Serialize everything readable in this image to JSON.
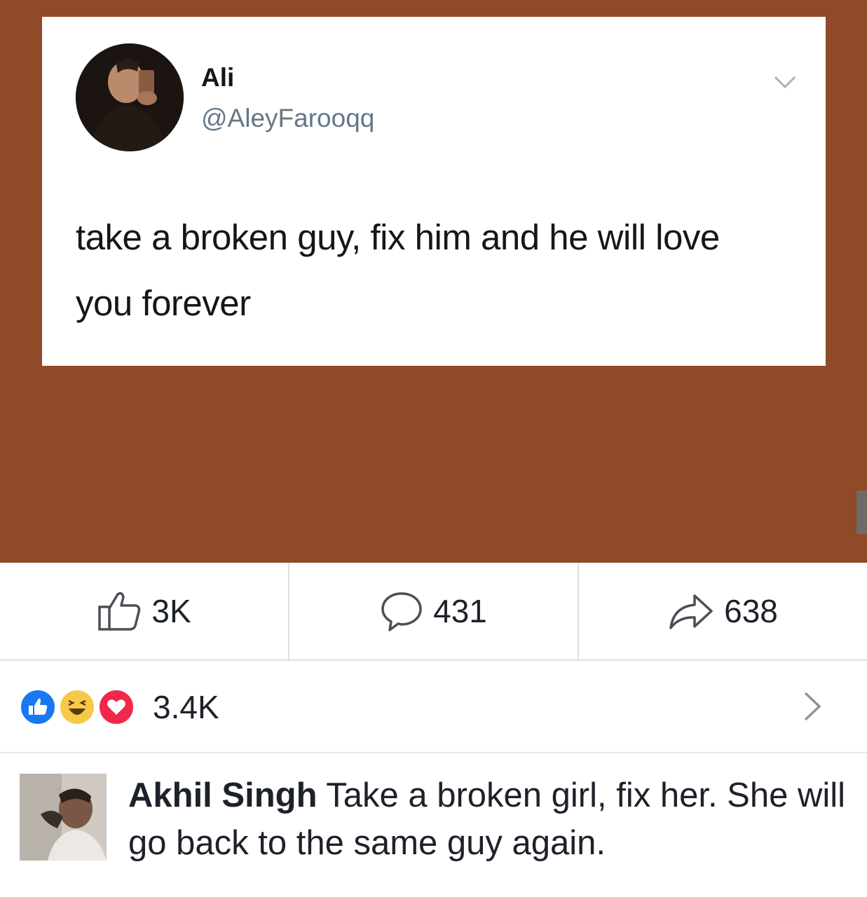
{
  "tweet": {
    "name": "Ali",
    "handle": "@AleyFarooqq",
    "text": "take a broken guy, fix him and he will love you forever",
    "menu_icon": "chevron-down-icon"
  },
  "colors": {
    "post_background": "#8f4a27",
    "reaction_like": "#1877f2",
    "reaction_haha": "#f7c94a",
    "reaction_love": "#f02849"
  },
  "actions": {
    "like": {
      "icon": "thumbs-up-icon",
      "count": "3K"
    },
    "comment": {
      "icon": "comment-bubble-icon",
      "count": "431"
    },
    "share": {
      "icon": "share-arrow-icon",
      "count": "638"
    }
  },
  "reactions": {
    "icons": [
      "like-reaction-icon",
      "haha-reaction-icon",
      "love-reaction-icon"
    ],
    "count": "3.4K"
  },
  "comment": {
    "author": "Akhil Singh",
    "text": "Take a broken girl, fix her. She will go back to the same guy again."
  }
}
